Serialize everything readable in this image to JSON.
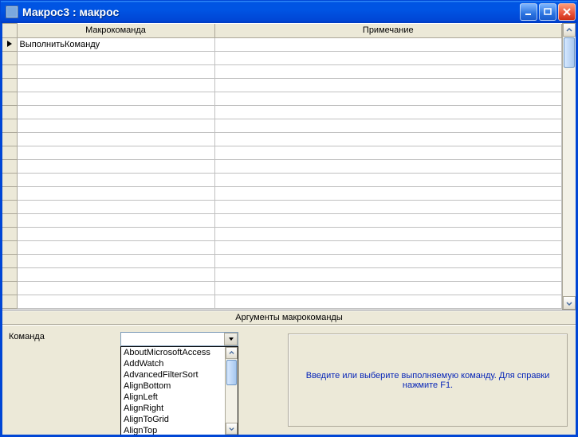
{
  "window": {
    "title": "Макрос3 : макрос"
  },
  "grid": {
    "columns": {
      "selector": "",
      "command": "Макрокоманда",
      "note": "Примечание"
    },
    "rows": [
      {
        "command": "ВыполнитьКоманду",
        "note": ""
      }
    ],
    "empty_row_count": 19
  },
  "arguments": {
    "section_title": "Аргументы макрокоманды",
    "field_label": "Команда",
    "combo_value": "",
    "options": [
      "AboutMicrosoftAccess",
      "AddWatch",
      "AdvancedFilterSort",
      "AlignBottom",
      "AlignLeft",
      "AlignRight",
      "AlignToGrid",
      "AlignTop"
    ],
    "help_text": "Введите или выберите выполняемую команду.  Для справки нажмите F1."
  }
}
